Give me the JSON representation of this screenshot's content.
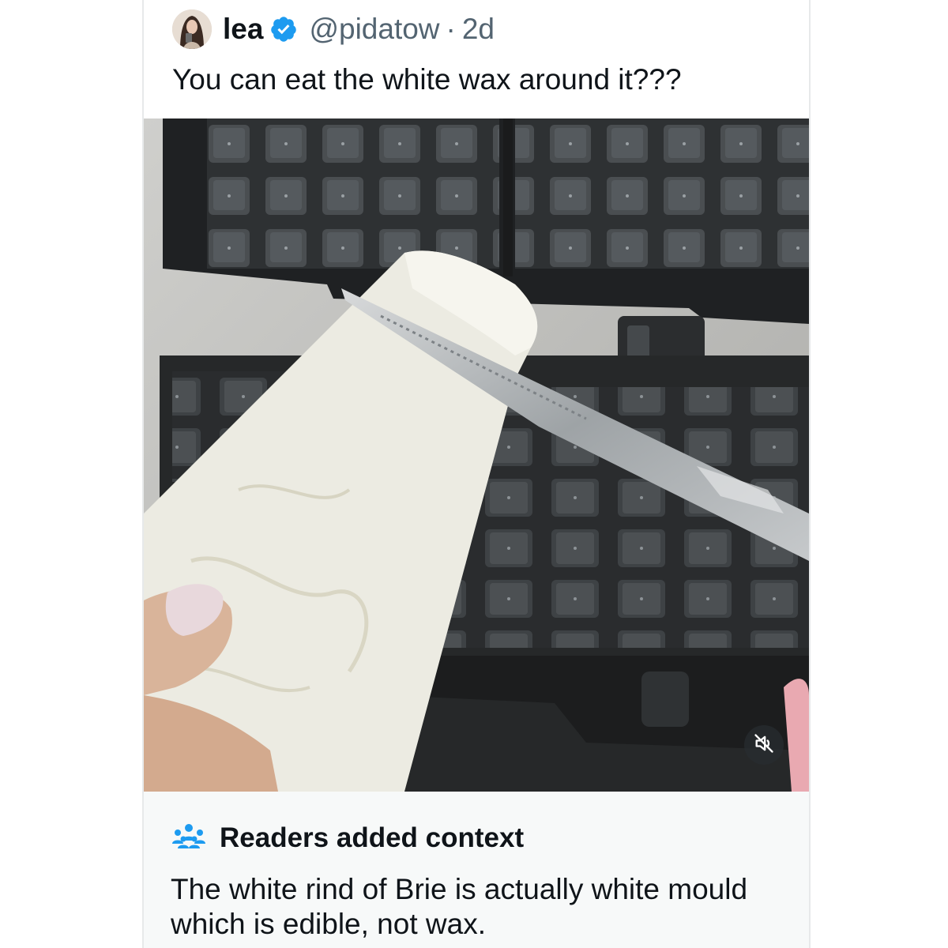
{
  "post": {
    "author_name": "lea",
    "author_handle": "@pidatow",
    "separator": "·",
    "age": "2d",
    "text": "You can eat the white wax around it???",
    "verified_icon": "verified-badge-icon",
    "accent_color": "#1d9bf0"
  },
  "media": {
    "mute_icon": "volume-muted-icon"
  },
  "context_note": {
    "icon": "people-icon",
    "title": "Readers added context",
    "body": "The white rind of Brie is actually white mould which is edible, not wax."
  }
}
